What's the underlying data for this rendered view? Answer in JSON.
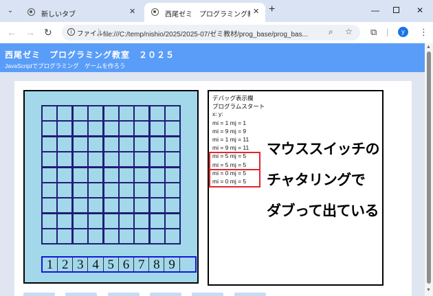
{
  "tabs": [
    {
      "title": "新しいタブ",
      "active": false
    },
    {
      "title": "西尾ゼミ　プログラミング教室　２",
      "active": true
    }
  ],
  "toolbar": {
    "scheme_chip": "ファイル",
    "url": "file:///C:/temp/nishio/2025/2025-07/ゼミ教材/prog_base/prog_bas...",
    "profile_initial": "y"
  },
  "page": {
    "title": "西尾ゼミ　プログラミング教室　２０２５",
    "subtitle": "JavaScriptでプログラミング　ゲームを作ろう"
  },
  "game": {
    "grid_rows": 9,
    "grid_cols": 9,
    "numbers": [
      "1",
      "2",
      "3",
      "4",
      "5",
      "6",
      "7",
      "8",
      "9",
      ""
    ]
  },
  "debug": {
    "lines": [
      "デバッグ表示欄",
      "プログラムスタート",
      "x: y:",
      "mi = 1 mj = 1",
      "mi = 9 mj = 9",
      "mi = 1 mj = 11",
      "mi = 9 mj = 11",
      "mi = 5 mj = 5",
      "mi = 5 mj = 5",
      "mi = 0 mj = 5",
      "mi = 0 mj = 5"
    ],
    "annotation": [
      "マウススイッチの",
      "チャタリングで",
      "ダブって出ている"
    ]
  },
  "colors": {
    "header_bg": "#5a9df9",
    "game_bg": "#a2d8ea",
    "grid_line": "#1f1d74",
    "highlight": "#e0262b"
  }
}
